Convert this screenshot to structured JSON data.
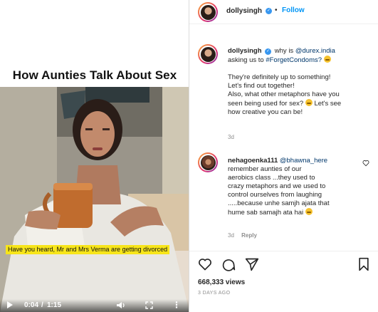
{
  "video": {
    "title": "How Aunties Talk About Sex",
    "caption": "Have you heard, Mr and Mrs Verma are getting divorced",
    "time_current": "0:04",
    "time_separator": "/",
    "time_total": "1:15"
  },
  "header": {
    "username": "dollysingh",
    "separator": "•",
    "follow_label": "Follow"
  },
  "post_caption": {
    "username": "dollysingh",
    "line_intro": "why is",
    "mention": "@durex.india",
    "line2_prefix": "asking us to",
    "hashtag": "#ForgetCondoms?",
    "para1_line1": "They're definitely up to something!",
    "para1_line2": "Let's find out together!",
    "para1_line3": "Also, what other metaphors have you",
    "para1_line4": "seen being used for sex?",
    "para1_line4_tail": "Let's see",
    "para1_line5": "how creative you can be!",
    "age": "3d"
  },
  "comment": {
    "username": "nehagoenka111",
    "mention": "@bhawna_here",
    "line1": "remember aunties of our",
    "line2": "aerobics class ...they used to",
    "line3": "crazy metaphors and we used to",
    "line4": "control ourselves from laughing",
    "line5": ".....because unhe samjh ajata that",
    "line6": "hume sab samajh ata hai",
    "age": "3d",
    "reply_label": "Reply"
  },
  "stats": {
    "views": "668,333 views",
    "posted": "3 DAYS AGO"
  },
  "colors": {
    "accent_blue": "#0095f6",
    "link_dark": "#00376b",
    "caption_yellow": "#f7e51a",
    "muted": "#8e8e8e"
  },
  "icons": [
    "play-icon",
    "volume-icon",
    "fullscreen-icon",
    "more-icon",
    "verified-icon",
    "heart-icon",
    "comment-icon",
    "bookmark-icon"
  ]
}
